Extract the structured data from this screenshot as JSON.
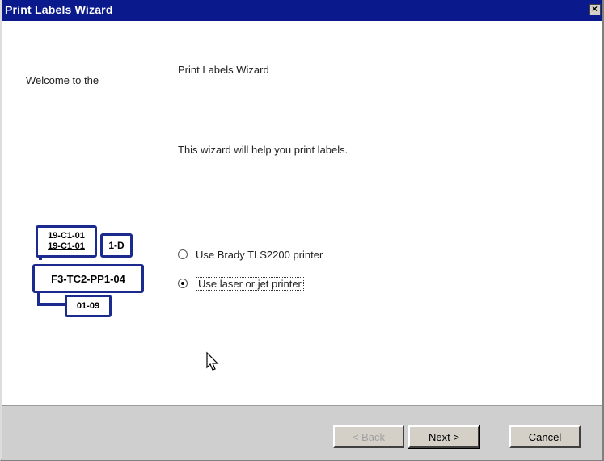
{
  "window": {
    "title": "Print Labels Wizard"
  },
  "left": {
    "welcome_text": "Welcome to the"
  },
  "labels_graphic": {
    "label1_line1": "19-C1-01",
    "label1_line2": "19-C1-01",
    "label2": "1-D",
    "label3": "F3-TC2-PP1-04",
    "label4": "01-09"
  },
  "main": {
    "wizard_title": "Print Labels Wizard",
    "description": "This wizard will help you print labels.",
    "options": [
      {
        "label": "Use Brady TLS2200 printer",
        "selected": false
      },
      {
        "label": "Use laser or jet printer",
        "selected": true
      }
    ]
  },
  "buttons": {
    "back": "< Back",
    "next": "Next >",
    "cancel": "Cancel"
  },
  "colors": {
    "titlebar": "#0a1a8c",
    "label_border": "#1b2a8e"
  }
}
